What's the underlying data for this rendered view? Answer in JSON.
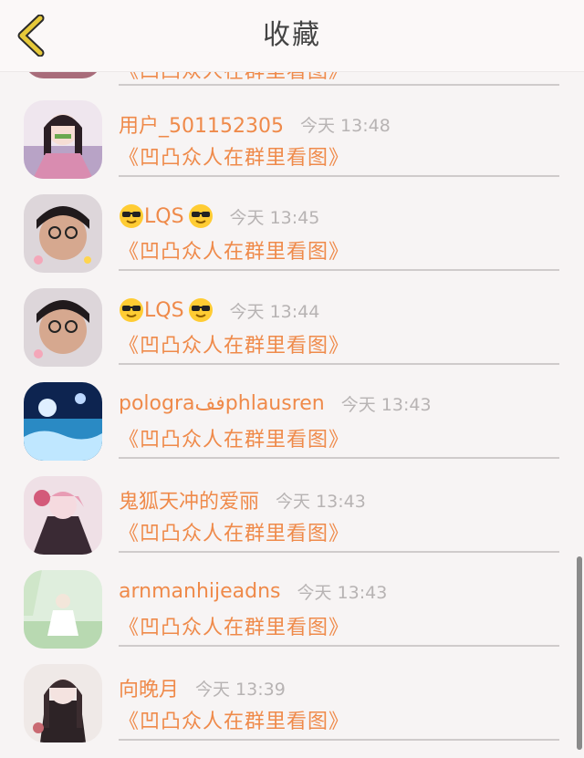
{
  "header": {
    "title": "收藏",
    "back_icon": "chevron-left-icon",
    "back_color": "#e6c93a"
  },
  "items": [
    {
      "user": "用户_501152305",
      "time": "今天 13:48",
      "message": "《凹凸众人在群里看图》"
    },
    {
      "user": "LQS",
      "time": "今天 13:45",
      "message": "《凹凸众人在群里看图》"
    },
    {
      "user": "LQS",
      "time": "今天 13:44",
      "message": "《凹凸众人在群里看图》"
    },
    {
      "user": "polograففphlausren",
      "time": "今天 13:43",
      "message": "《凹凸众人在群里看图》"
    },
    {
      "user": "鬼狐天冲的爱丽",
      "time": "今天 13:43",
      "message": "《凹凸众人在群里看图》"
    },
    {
      "user": "arnmanhijeadns",
      "time": "今天 13:43",
      "message": "《凹凸众人在群里看图》"
    },
    {
      "user": "向晚月",
      "time": "今天 13:39",
      "message": "《凹凸众人在群里看图》"
    }
  ],
  "partial_top": {
    "message": "《凹凸众人在群里看图》"
  },
  "colors": {
    "accent": "#ef8a4a",
    "time": "#b7b3b3",
    "background": "#f7f4f4"
  }
}
